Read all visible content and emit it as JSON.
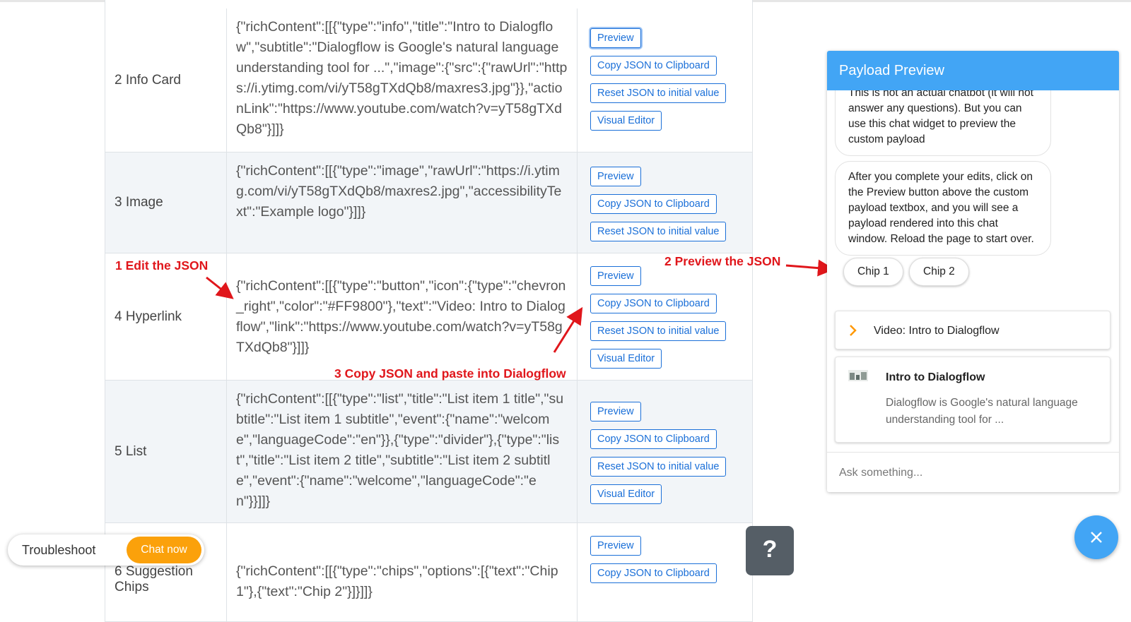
{
  "table": {
    "rows": [
      {
        "name": "2 Info Card",
        "json": "{\"richContent\":[[{\"type\":\"info\",\"title\":\"Intro to Dialogflow\",\"subtitle\":\"Dialogflow is Google's natural language understanding tool for ...\",\"image\":{\"src\":{\"rawUrl\":\"https://i.ytimg.com/vi/yT58gTXdQb8/maxres3.jpg\"}},\"actionLink\":\"https://www.youtube.com/watch?v=yT58gTXdQb8\"}]]}",
        "buttons": [
          "Preview",
          "Copy JSON to Clipboard",
          "Reset JSON to initial value",
          "Visual Editor"
        ]
      },
      {
        "name": "3 Image",
        "json": "{\"richContent\":[[{\"type\":\"image\",\"rawUrl\":\"https://i.ytimg.com/vi/yT58gTXdQb8/maxres2.jpg\",\"accessibilityText\":\"Example logo\"}]]}",
        "buttons": [
          "Preview",
          "Copy JSON to Clipboard",
          "Reset JSON to initial value"
        ]
      },
      {
        "name": "4 Hyperlink",
        "json": "{\"richContent\":[[{\"type\":\"button\",\"icon\":{\"type\":\"chevron_right\",\"color\":\"#FF9800\"},\"text\":\"Video: Intro to Dialogflow\",\"link\":\"https://www.youtube.com/watch?v=yT58gTXdQb8\"}]]}",
        "buttons": [
          "Preview",
          "Copy JSON to Clipboard",
          "Reset JSON to initial value",
          "Visual Editor"
        ]
      },
      {
        "name": "5 List",
        "json": "{\"richContent\":[[{\"type\":\"list\",\"title\":\"List item 1 title\",\"subtitle\":\"List item 1 subtitle\",\"event\":{\"name\":\"welcome\",\"languageCode\":\"en\"}},{\"type\":\"divider\"},{\"type\":\"list\",\"title\":\"List item 2 title\",\"subtitle\":\"List item 2 subtitle\",\"event\":{\"name\":\"welcome\",\"languageCode\":\"en\"}}]]}",
        "buttons": [
          "Preview",
          "Copy JSON to Clipboard",
          "Reset JSON to initial value",
          "Visual Editor"
        ]
      },
      {
        "name": "6 Suggestion Chips",
        "json": "{\"richContent\":[[{\"type\":\"chips\",\"options\":[{\"text\":\"Chip 1\"},{\"text\":\"Chip 2\"}]}]]}",
        "buttons": [
          "Preview",
          "Copy JSON to Clipboard"
        ]
      }
    ]
  },
  "annotations": {
    "edit": "1 Edit the JSON",
    "preview": "2 Preview the JSON",
    "copy": "3 Copy JSON and paste into Dialogflow",
    "color": "#e0161b"
  },
  "chat": {
    "title": "Payload Preview",
    "messages": [
      "This is not an actual chatbot (it will not answer any questions). But you can use this chat widget to preview the custom payload",
      "After you complete your edits, click on the Preview button above the custom payload textbox, and you will see a payload rendered into this chat window. Reload the page to start over."
    ],
    "chips": [
      "Chip 1",
      "Chip 2"
    ],
    "hyperlink": {
      "icon": "chevron-right-icon",
      "icon_color": "#FF9800",
      "text": "Video: Intro to Dialogflow"
    },
    "info_card": {
      "icon": "thumbnail-image-icon",
      "title": "Intro to Dialogflow",
      "subtitle": "Dialogflow is Google's natural language understanding tool for ..."
    },
    "input_placeholder": "Ask something...",
    "accent_color": "#42a5f5"
  },
  "close_button": {
    "icon": "close-icon"
  },
  "help_button": {
    "label": "?"
  },
  "support": {
    "label": "Troubleshoot",
    "chat_now": "Chat now",
    "chat_now_color": "#fba10b"
  }
}
